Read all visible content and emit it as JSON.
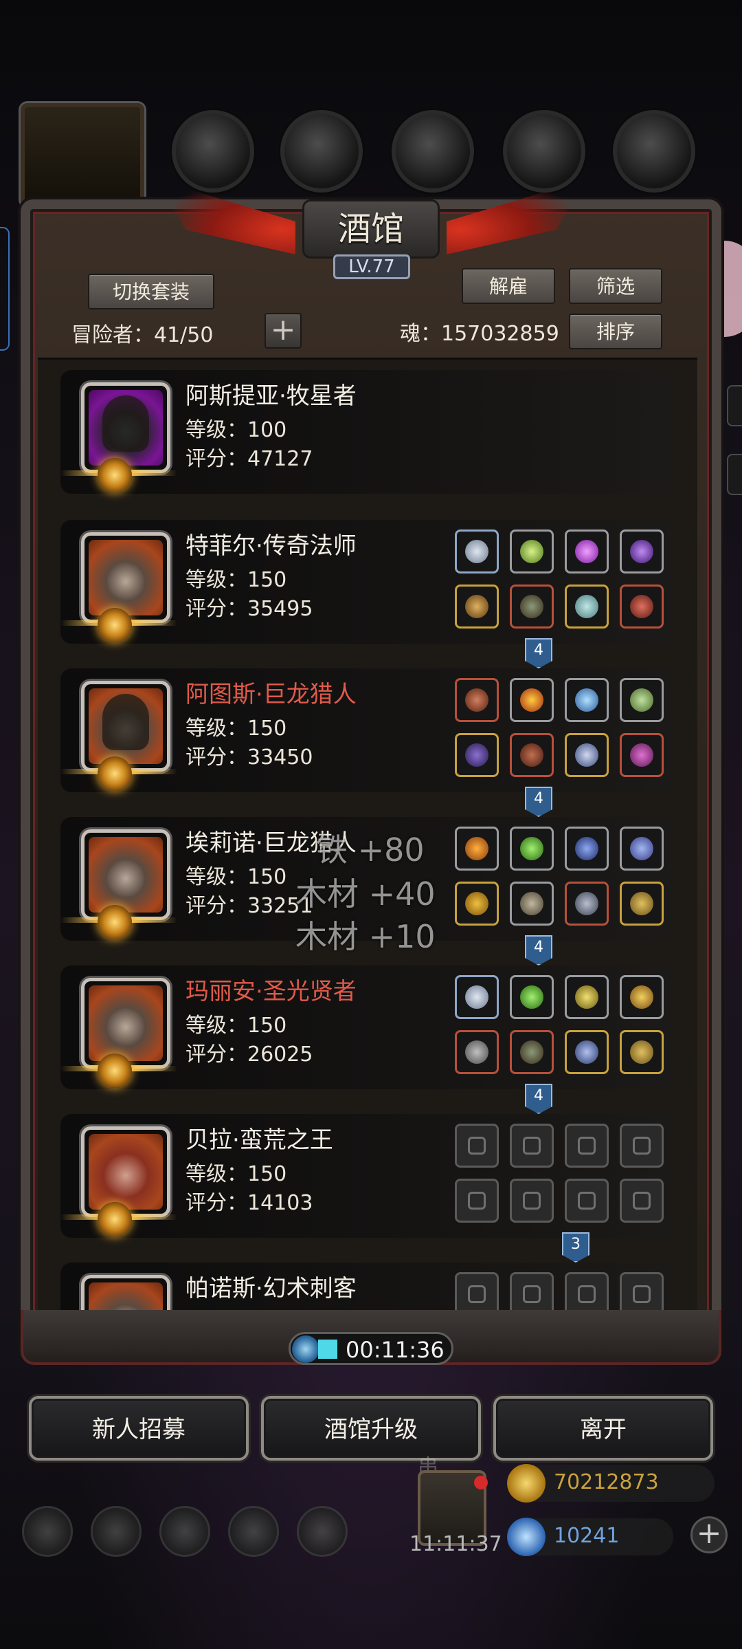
{
  "tavern": {
    "title": "酒馆",
    "level": "LV.77",
    "switch_outfit_label": "切换套装",
    "dismiss_label": "解雇",
    "filter_label": "筛选",
    "sort_label": "排序",
    "adventurers_label": "冒险者：41/50",
    "soul_label": "魂：157032859",
    "plus_label": "+"
  },
  "heroes": [
    {
      "name": "阿斯提亚·牧星者",
      "level": "等级：100",
      "score": "评分：47127"
    },
    {
      "name": "特菲尔·传奇法师",
      "level": "等级：150",
      "score": "评分：35495",
      "link": "4"
    },
    {
      "name": "阿图斯·巨龙猎人",
      "level": "等级：150",
      "score": "评分：33450",
      "link": "4"
    },
    {
      "name": "埃莉诺·巨龙猎人",
      "level": "等级：150",
      "score": "评分：33251",
      "link": "4"
    },
    {
      "name": "玛丽安·圣光贤者",
      "level": "等级：150",
      "score": "评分：26025",
      "link": "4"
    },
    {
      "name": "贝拉·蛮荒之王",
      "level": "等级：150",
      "score": "评分：14103",
      "link": "3"
    },
    {
      "name": "帕诺斯·幻术刺客"
    }
  ],
  "floating_texts": [
    "铁 +80",
    "木材 +40",
    "木材 +10"
  ],
  "timer": "00:11:36",
  "actions": {
    "recruit_label": "新人招募",
    "upgrade_label": "酒馆升级",
    "leave_label": "离开"
  },
  "hud": {
    "gift_time": "11:11:37",
    "gold": "70212873",
    "gems": "10241",
    "add_label": "+",
    "gift_label": "串"
  },
  "colors": {
    "name_red": "#e05a4a",
    "accent_red": "#d9331f",
    "link_blue": "#2e5d8e",
    "gold_text": "#c9a23d",
    "gem_text": "#6fa3e0"
  }
}
